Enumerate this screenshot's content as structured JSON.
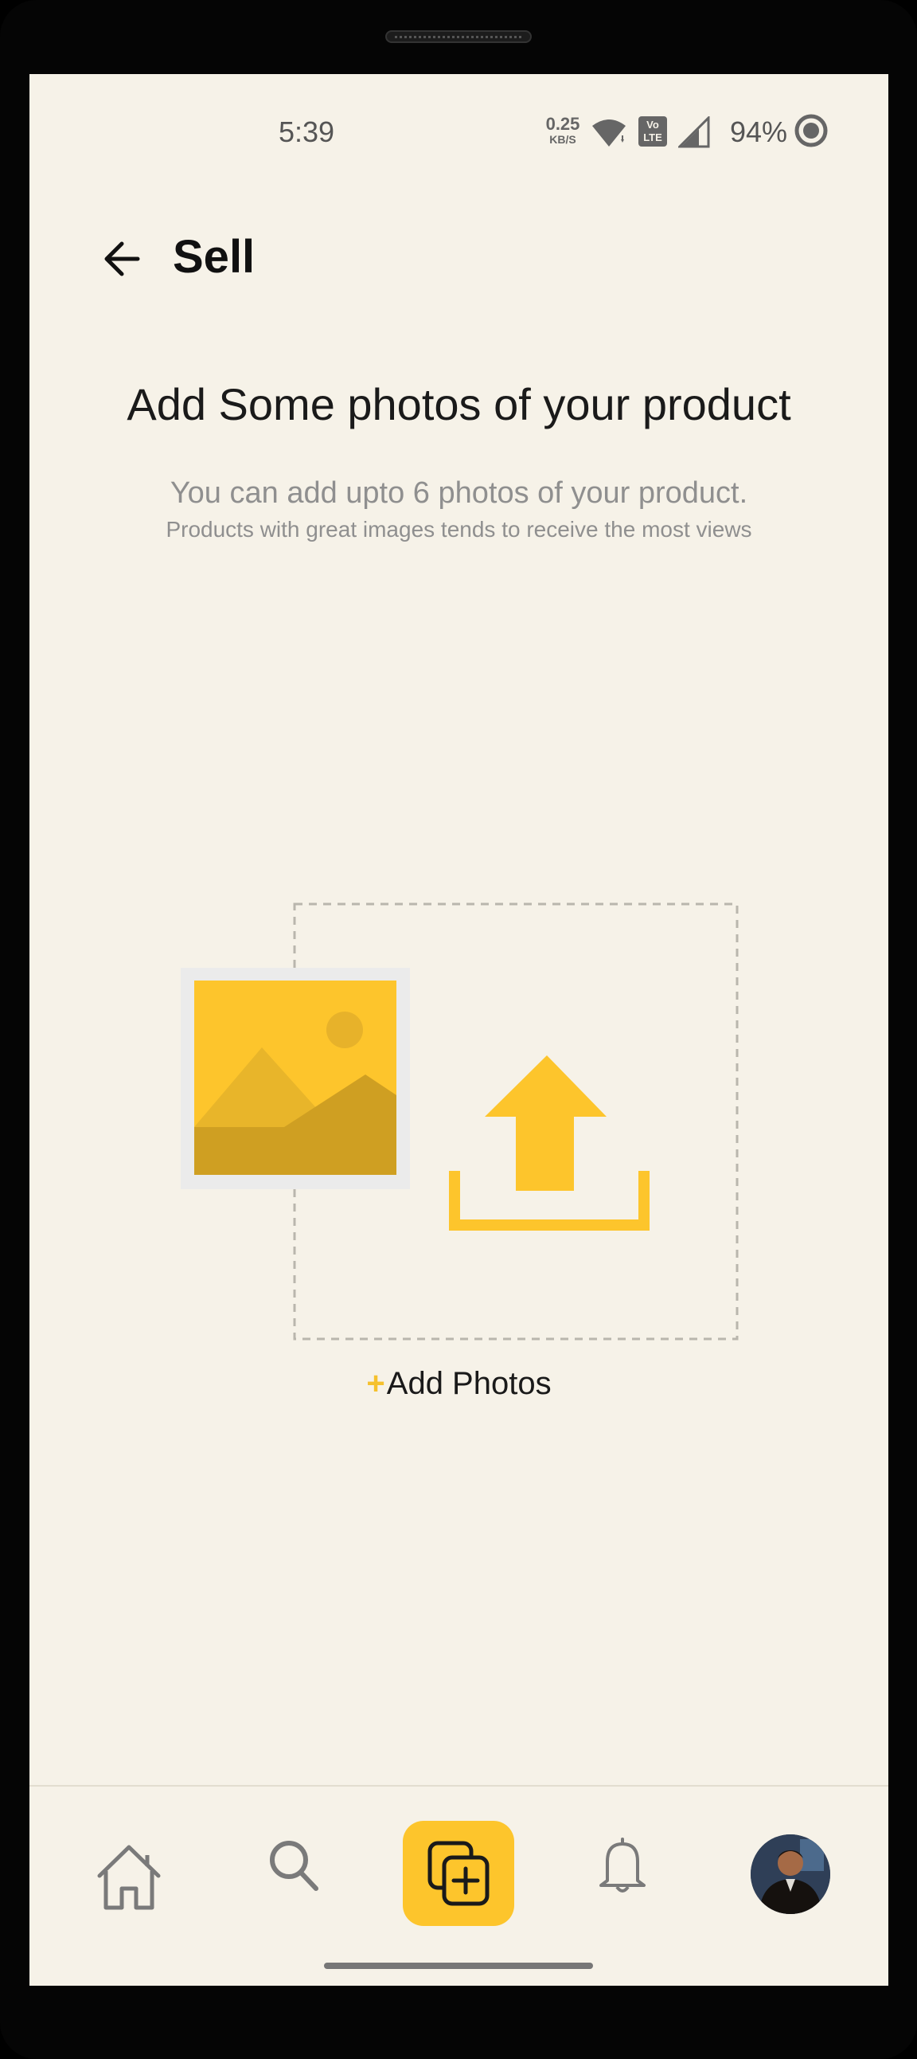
{
  "status_bar": {
    "time": "5:39",
    "net_speed_value": "0.25",
    "net_speed_unit": "KB/S",
    "volte_line1": "Vo",
    "volte_line2": "LTE",
    "battery_percent": "94%",
    "icons": [
      "wifi-icon",
      "volte-icon",
      "signal-icon",
      "battery-icon"
    ]
  },
  "header": {
    "back_icon": "arrow-left-icon",
    "title": "Sell"
  },
  "main": {
    "heading": "Add Some photos of your product",
    "subtitle": "You can add upto 6 photos of your product.",
    "subtext": "Products with great images tends to receive the most views",
    "illustration": "image-upload-illustration",
    "add_photos_plus": "+",
    "add_photos_label": "Add Photos"
  },
  "bottom_nav": {
    "items": [
      {
        "name": "home",
        "icon": "home-icon",
        "active": false
      },
      {
        "name": "search",
        "icon": "search-icon",
        "active": false
      },
      {
        "name": "sell",
        "icon": "add-listing-icon",
        "active": true
      },
      {
        "name": "notifications",
        "icon": "bell-icon",
        "active": false
      },
      {
        "name": "profile",
        "icon": "avatar",
        "active": false
      }
    ]
  },
  "colors": {
    "background": "#f6f2e8",
    "accent": "#fdc52c",
    "text_primary": "#1a1a1a",
    "text_secondary": "#8f8f8f"
  }
}
